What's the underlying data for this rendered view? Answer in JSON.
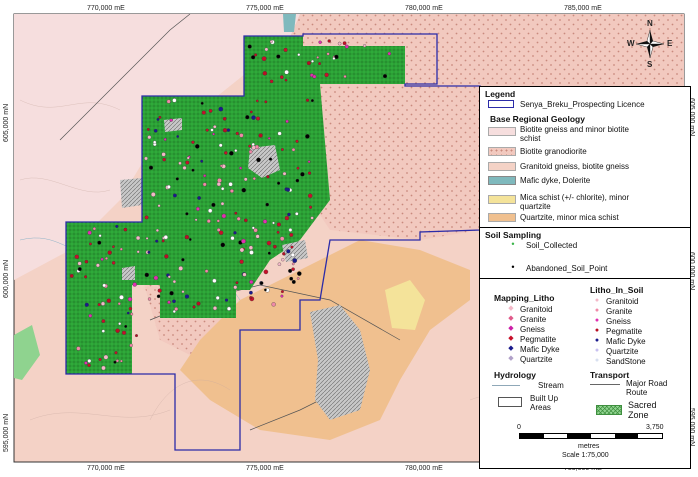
{
  "map": {
    "top_coords": [
      "770,000 mE",
      "775,000 mE",
      "780,000 mE",
      "785,000 mE"
    ],
    "bottom_coords": [
      "770,000 mE",
      "775,000 mE",
      "780,000 mE",
      "785,000 mE"
    ],
    "left_coords": [
      "605,000 mN",
      "600,000 mN",
      "595,000 mN"
    ],
    "right_coords": [
      "605,000 mN",
      "600,000 mN",
      "595,000 mN"
    ],
    "colors": {
      "biotite_gneiss": "#f6dede",
      "granodiorite": "#f2c9bf",
      "granitoid_gneiss": "#f4d2c6",
      "mafic_dyke": "#7fb9bd",
      "mica_schist": "#f4e39a",
      "quartzite": "#f0c08f",
      "licence_outline": "#2b2ba8",
      "soil_collected": "#3bb54a",
      "sacred_zone": "#8fd38f"
    }
  },
  "compass": {
    "n": "N",
    "s": "S",
    "e": "E",
    "w": "W"
  },
  "legend": {
    "title": "Legend",
    "licence_label": "Senya_Breku_Prospecting Licence",
    "geology_title": "Base Regional Geology",
    "geology": [
      {
        "label_lines": [
          "Biotite gneiss and minor biotite",
          "schist"
        ],
        "color": "#f6dede"
      },
      {
        "label_lines": [
          "Biotite granodiorite"
        ],
        "color": "#f2c9bf"
      },
      {
        "label_lines": [
          "Granitoid gneiss, biotite gneiss"
        ],
        "color": "#f4d2c6"
      },
      {
        "label_lines": [
          "Mafic dyke, Dolerite"
        ],
        "color": "#7fb9bd"
      },
      {
        "label_lines": [
          "Mica schist (+/- chlorite), minor",
          "quartzite"
        ],
        "color": "#f4e39a"
      },
      {
        "label_lines": [
          "Quartzite, minor mica schist"
        ],
        "color": "#f0c08f"
      }
    ],
    "soil_title": "Soil Sampling",
    "soil_collected": "Soil_Collected",
    "abandoned": "Abandoned_Soil_Point",
    "mapping_title": "Mapping_Litho",
    "mapping": [
      {
        "label": "Granitoid",
        "color": "#f3b8c8"
      },
      {
        "label": "Granite",
        "color": "#e05a8a"
      },
      {
        "label": "Gneiss",
        "color": "#cc1fa7"
      },
      {
        "label": "Pegmatite",
        "color": "#c7102a"
      },
      {
        "label": "Mafic Dyke",
        "color": "#1a1a8c"
      },
      {
        "label": "Quartzite",
        "color": "#b0a0c8"
      }
    ],
    "litho_soil_title": "Litho_In_Soil",
    "litho_soil": [
      {
        "label": "Granitoid",
        "color": "#f3b8c8"
      },
      {
        "label": "Granite",
        "color": "#f08aa8"
      },
      {
        "label": "Gneiss",
        "color": "#e030b0"
      },
      {
        "label": "Pegmatite",
        "color": "#b80f24"
      },
      {
        "label": "Mafic Dyke",
        "color": "#1a1a8c"
      },
      {
        "label": "Quartzite",
        "color": "#c8c0f0"
      },
      {
        "label": "SandStone",
        "color": "#d8e0f0"
      }
    ],
    "hydrology_title": "Hydrology",
    "stream": "Stream",
    "transport_title": "Transport",
    "road_lines": [
      "Major Road",
      "Route"
    ],
    "built_up_lines": [
      "Built Up",
      "Areas"
    ],
    "sacred_lines": [
      "Sacred",
      "Zone"
    ],
    "scale_zero": "0",
    "scale_max": "3,750",
    "scale_units": "metres",
    "scale_text": "Scale 1:75,000"
  }
}
